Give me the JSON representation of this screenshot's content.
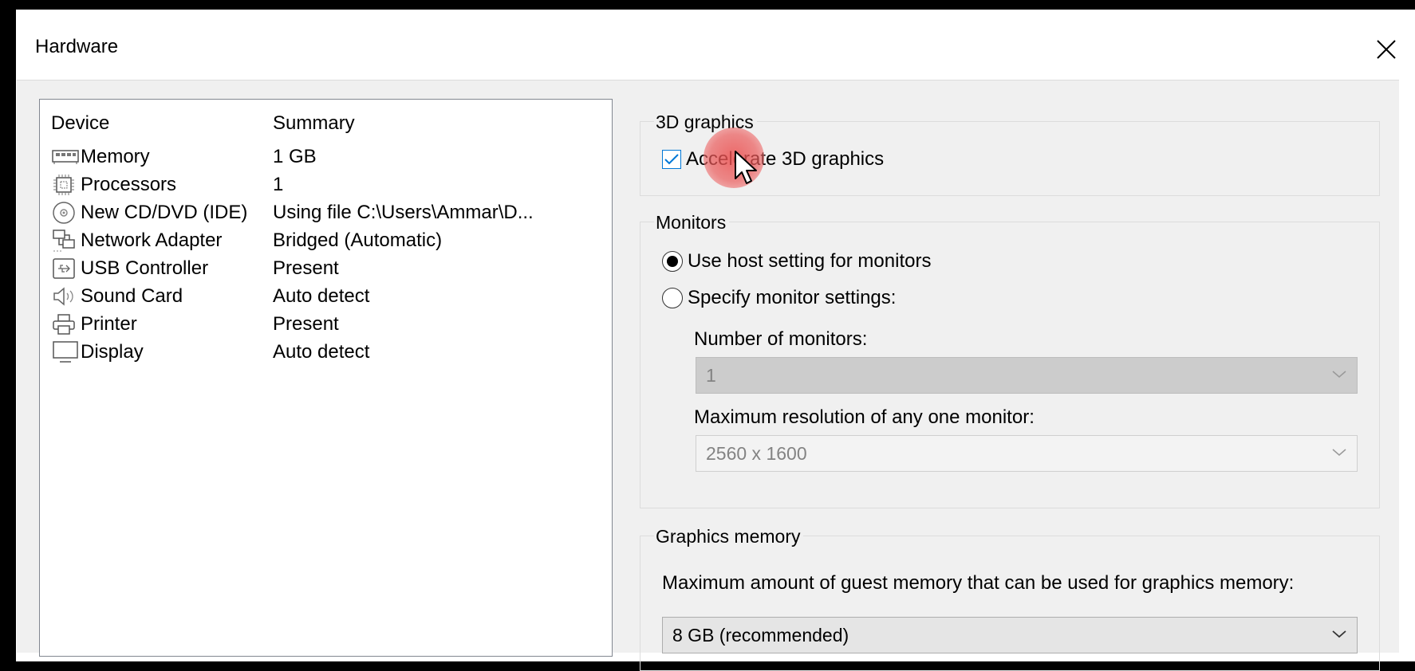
{
  "window": {
    "title": "Hardware",
    "close_icon": "close-icon"
  },
  "device_list": {
    "headers": {
      "device": "Device",
      "summary": "Summary"
    },
    "rows": [
      {
        "icon": "memory-icon",
        "device": "Memory",
        "summary": "1 GB"
      },
      {
        "icon": "processor-icon",
        "device": "Processors",
        "summary": "1"
      },
      {
        "icon": "cd-dvd-icon",
        "device": "New CD/DVD (IDE)",
        "summary": "Using file C:\\Users\\Ammar\\D..."
      },
      {
        "icon": "network-adapter-icon",
        "device": "Network Adapter",
        "summary": "Bridged (Automatic)"
      },
      {
        "icon": "usb-controller-icon",
        "device": "USB Controller",
        "summary": "Present"
      },
      {
        "icon": "sound-card-icon",
        "device": "Sound Card",
        "summary": "Auto detect"
      },
      {
        "icon": "printer-icon",
        "device": "Printer",
        "summary": "Present"
      },
      {
        "icon": "display-icon",
        "device": "Display",
        "summary": "Auto detect"
      }
    ]
  },
  "graphics_3d": {
    "group_title": "3D graphics",
    "accelerate_label": "Accelerate 3D graphics",
    "accelerate_checked": true
  },
  "monitors": {
    "group_title": "Monitors",
    "use_host_label": "Use host setting for monitors",
    "specify_label": "Specify monitor settings:",
    "selected": "use_host",
    "number_label": "Number of monitors:",
    "number_value": "1",
    "max_res_label": "Maximum resolution of any one monitor:",
    "max_res_value": "2560 x 1600"
  },
  "graphics_memory": {
    "group_title": "Graphics memory",
    "description": "Maximum amount of guest memory that can be used for graphics memory:",
    "value": "8 GB (recommended)"
  },
  "colors": {
    "accent": "#0078d7",
    "dialog_bg": "#f0f0f0",
    "disabled_bg": "#cccccc"
  }
}
